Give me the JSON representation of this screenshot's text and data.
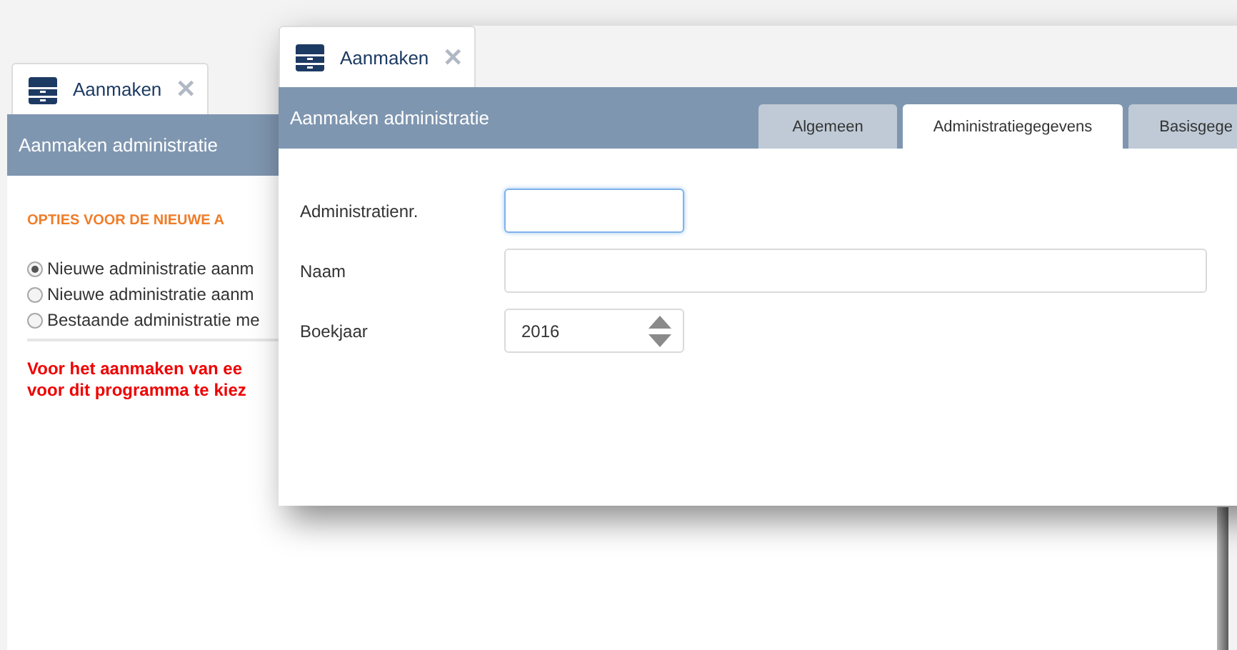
{
  "back_window": {
    "tab": {
      "label": "Aanmaken",
      "close": "✕"
    },
    "title": "Aanmaken administratie",
    "section_heading": "OPTIES VOOR DE NIEUWE A",
    "options": [
      {
        "label": "Nieuwe administratie aanm",
        "selected": true
      },
      {
        "label": "Nieuwe administratie aanm",
        "selected": false
      },
      {
        "label": "Bestaande administratie me",
        "selected": false
      }
    ],
    "warning": [
      "Voor het aanmaken van ee",
      "voor dit programma te kiez"
    ]
  },
  "front_window": {
    "tab": {
      "label": "Aanmaken",
      "close": "✕"
    },
    "title": "Aanmaken administratie",
    "tabs": [
      {
        "label": "Algemeen",
        "selected": false
      },
      {
        "label": "Administratiegegevens",
        "selected": true
      },
      {
        "label": "Basisgege",
        "selected": false
      }
    ],
    "fields": [
      {
        "kind": "text",
        "label": "Administratienr.",
        "focused": true,
        "wide": false
      },
      {
        "kind": "text",
        "label": "Naam",
        "focused": false,
        "wide": true
      },
      {
        "kind": "spinner",
        "label": "Boekjaar",
        "value": "2016",
        "focused": false,
        "wide": false
      }
    ]
  }
}
